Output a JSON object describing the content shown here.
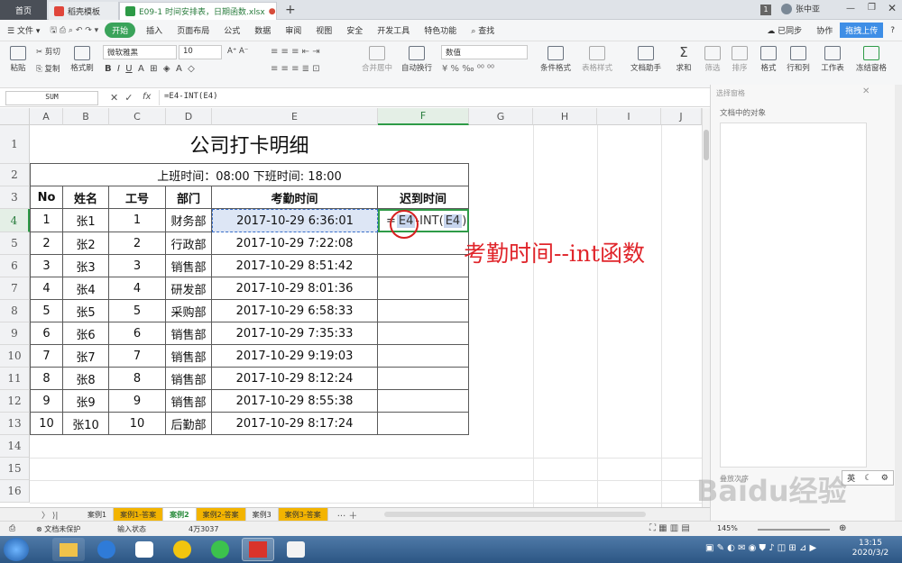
{
  "tabs": {
    "home": "首页",
    "template": "稻壳模板",
    "file": "E09-1 时间安排表，日期函数.xlsx",
    "new": "+"
  },
  "title_bar": {
    "count": "1",
    "user": "张中亚"
  },
  "menu": {
    "file": "文件",
    "start": "开始",
    "items": [
      "插入",
      "页面布局",
      "公式",
      "数据",
      "审阅",
      "视图",
      "安全",
      "开发工具",
      "特色功能"
    ],
    "search": "查找",
    "sync": "已同步",
    "share": "协作",
    "upload": "拖拽上传",
    "help": "?"
  },
  "ribbon": {
    "paste": "粘贴",
    "cut": "剪切",
    "copy": "复制",
    "format_painter": "格式刷",
    "font_name": "微软雅黑",
    "font_size": "10",
    "merge": "合并居中",
    "wrap": "自动换行",
    "number_format": "数值",
    "cond_format": "条件格式",
    "table_style": "表格样式",
    "doc_helper": "文档助手",
    "sum": "求和",
    "filter": "筛选",
    "sort": "排序",
    "format": "格式",
    "rowcol": "行和列",
    "sheet": "工作表",
    "freeze": "冻结窗格"
  },
  "formula_bar": {
    "name_box": "SUM",
    "fx": "fx",
    "formula": "=E4-INT(E4)"
  },
  "columns": [
    "A",
    "B",
    "C",
    "D",
    "E",
    "F",
    "G",
    "H",
    "I",
    "J"
  ],
  "rows": [
    "1",
    "2",
    "3",
    "4",
    "5",
    "6",
    "7",
    "8",
    "9",
    "10",
    "11",
    "12",
    "13",
    "14",
    "15",
    "16"
  ],
  "sheet": {
    "title": "公司打卡明细",
    "subtitle": "上班时间：08:00    下班时间: 18:00",
    "headers": [
      "No",
      "姓名",
      "工号",
      "部门",
      "考勤时间",
      "迟到时间"
    ],
    "records": [
      {
        "no": "1",
        "name": "张1",
        "id": "1",
        "dept": "财务部",
        "time": "2017-10-29 6:36:01"
      },
      {
        "no": "2",
        "name": "张2",
        "id": "2",
        "dept": "行政部",
        "time": "2017-10-29 7:22:08"
      },
      {
        "no": "3",
        "name": "张3",
        "id": "3",
        "dept": "销售部",
        "time": "2017-10-29 8:51:42"
      },
      {
        "no": "4",
        "name": "张4",
        "id": "4",
        "dept": "研发部",
        "time": "2017-10-29 8:01:36"
      },
      {
        "no": "5",
        "name": "张5",
        "id": "5",
        "dept": "采购部",
        "time": "2017-10-29 6:58:33"
      },
      {
        "no": "6",
        "name": "张6",
        "id": "6",
        "dept": "销售部",
        "time": "2017-10-29 7:35:33"
      },
      {
        "no": "7",
        "name": "张7",
        "id": "7",
        "dept": "销售部",
        "time": "2017-10-29 9:19:03"
      },
      {
        "no": "8",
        "name": "张8",
        "id": "8",
        "dept": "销售部",
        "time": "2017-10-29 8:12:24"
      },
      {
        "no": "9",
        "name": "张9",
        "id": "9",
        "dept": "销售部",
        "time": "2017-10-29 8:55:38"
      },
      {
        "no": "10",
        "name": "张10",
        "id": "10",
        "dept": "后勤部",
        "time": "2017-10-29 8:17:24"
      }
    ],
    "editing": {
      "eq": "=",
      "ref1": "E4",
      "minus": "-",
      "fn": "INT(",
      "ref2": "E4",
      "close": ")"
    }
  },
  "annotation": "考勤时间--int函数",
  "sheet_tabs": [
    "案例1",
    "案例1-答案",
    "案例2",
    "案例2-答案",
    "案例3",
    "案例3-答案"
  ],
  "status": {
    "protect": "文档未保护",
    "mode": "输入状态",
    "cell_info": "4万3037",
    "zoom": "145%"
  },
  "panel": {
    "title": "选择窗格",
    "objects": "文档中的对象",
    "order": "叠放次序",
    "ime": "英"
  },
  "watermark": "Baidu经验",
  "taskbar": {
    "time": "13:15",
    "date": "2020/3/2"
  }
}
